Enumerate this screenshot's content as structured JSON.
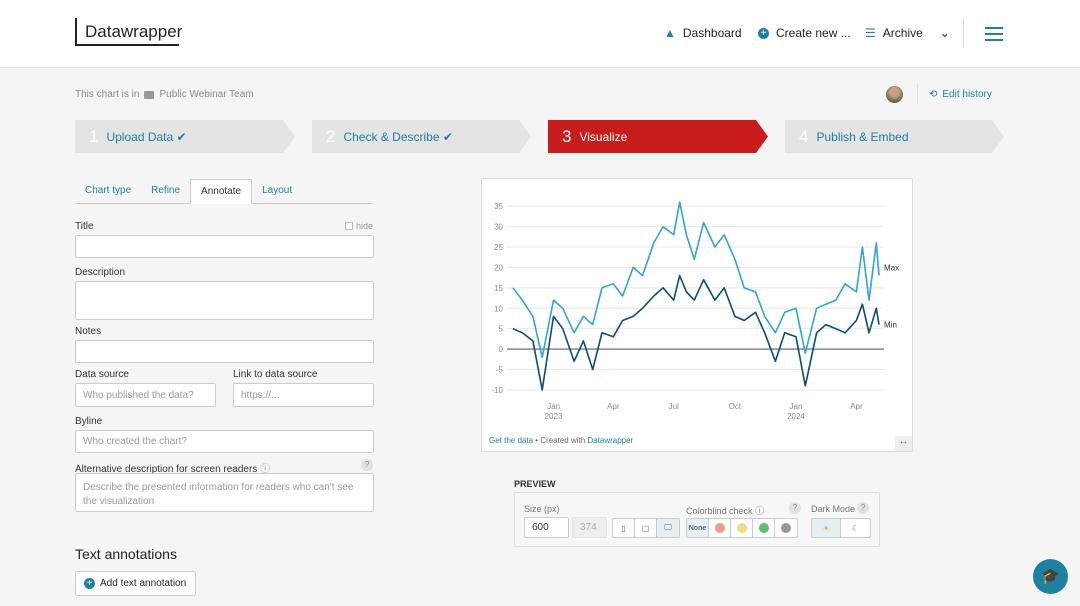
{
  "header": {
    "logo": "Datawrapper",
    "dashboard": "Dashboard",
    "create_new": "Create new ...",
    "archive": "Archive"
  },
  "breadcrumb": {
    "prefix": "This chart is in",
    "folder": "Public Webinar Team",
    "edit_history": "Edit history"
  },
  "steps": [
    {
      "num": "1",
      "label": "Upload Data",
      "done": true
    },
    {
      "num": "2",
      "label": "Check & Describe",
      "done": true
    },
    {
      "num": "3",
      "label": "Visualize",
      "active": true
    },
    {
      "num": "4",
      "label": "Publish & Embed"
    }
  ],
  "tabs": [
    "Chart type",
    "Refine",
    "Annotate",
    "Layout"
  ],
  "form": {
    "title_label": "Title",
    "hide_label": "hide",
    "title_value": "",
    "description_label": "Description",
    "notes_label": "Notes",
    "source_label": "Data source",
    "source_placeholder": "Who published the data?",
    "link_label": "Link to data source",
    "link_placeholder": "https://...",
    "byline_label": "Byline",
    "byline_placeholder": "Who created the chart?",
    "alt_label": "Alternative description for screen readers",
    "alt_placeholder": "Describe the presented information for readers who can't see the visualization",
    "text_annotations": "Text annotations",
    "add_annotation": "Add text annotation"
  },
  "preview": {
    "title": "PREVIEW",
    "size_label": "Size (px)",
    "width": "600",
    "height": "374",
    "colorblind_label": "Colorblind check",
    "none": "None",
    "dark_mode_label": "Dark Mode"
  },
  "colors": {
    "accent": "#1d81a2",
    "active_step": "#c71e1d",
    "max": "#32a3d4",
    "min": "#0c4c75"
  },
  "chart_data": {
    "type": "line",
    "y_ticks": [
      35,
      30,
      25,
      20,
      15,
      10,
      5,
      0,
      -5,
      -10
    ],
    "ylim": [
      -11,
      37
    ],
    "x_ticks": [
      {
        "date": "2023-01-01",
        "label": "Jan",
        "sub": "2023"
      },
      {
        "date": "2023-04-01",
        "label": "Apr"
      },
      {
        "date": "2023-07-01",
        "label": "Jul"
      },
      {
        "date": "2023-10-01",
        "label": "Oct"
      },
      {
        "date": "2024-01-01",
        "label": "Jan",
        "sub": "2024"
      },
      {
        "date": "2024-04-01",
        "label": "Apr"
      }
    ],
    "xlim": [
      "2022-11-01",
      "2024-05-05"
    ],
    "grid": true,
    "x": [
      "2022-11-01",
      "2022-11-15",
      "2022-12-01",
      "2022-12-15",
      "2023-01-01",
      "2023-01-15",
      "2023-02-01",
      "2023-02-15",
      "2023-03-01",
      "2023-03-15",
      "2023-04-01",
      "2023-04-15",
      "2023-05-01",
      "2023-05-15",
      "2023-06-01",
      "2023-06-15",
      "2023-07-01",
      "2023-07-10",
      "2023-07-20",
      "2023-08-01",
      "2023-08-15",
      "2023-09-01",
      "2023-09-15",
      "2023-10-01",
      "2023-10-15",
      "2023-11-01",
      "2023-11-15",
      "2023-12-01",
      "2023-12-15",
      "2024-01-01",
      "2024-01-15",
      "2024-02-01",
      "2024-02-15",
      "2024-03-01",
      "2024-03-15",
      "2024-04-01",
      "2024-04-10",
      "2024-04-20",
      "2024-05-01",
      "2024-05-05"
    ],
    "series": [
      {
        "name": "Max",
        "values": [
          15,
          12,
          8,
          -2,
          12,
          10,
          4,
          8,
          6,
          15,
          16,
          13,
          20,
          18,
          26,
          30,
          28,
          36,
          28,
          22,
          31,
          25,
          28,
          22,
          15,
          14,
          8,
          4,
          9,
          10,
          -1,
          10,
          11,
          12,
          16,
          14,
          25,
          12,
          26,
          18
        ]
      },
      {
        "name": "Min",
        "values": [
          5,
          4,
          2,
          -10,
          8,
          5,
          -3,
          2,
          -5,
          4,
          3,
          7,
          8,
          10,
          13,
          15,
          12,
          18,
          14,
          12,
          17,
          12,
          15,
          8,
          7,
          9,
          4,
          -3,
          4,
          3,
          -9,
          4,
          6,
          5,
          4,
          7,
          11,
          4,
          10,
          6
        ]
      }
    ],
    "footer": {
      "get_data": "Get the data",
      "created_with": " • Created with ",
      "brand": "Datawrapper"
    }
  }
}
